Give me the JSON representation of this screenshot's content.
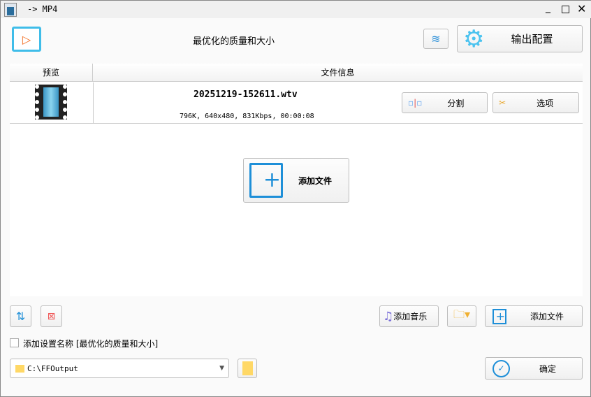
{
  "window": {
    "title": "-> MP4"
  },
  "header": {
    "preset": "最优化的质量和大小",
    "output_config": "输出配置"
  },
  "list": {
    "columns": [
      "预览",
      "文件信息"
    ],
    "files": [
      {
        "name": "20251219-152611.wtv",
        "info": "796K, 640x480, 831Kbps, 00:00:08",
        "split": "分割",
        "options": "选项"
      }
    ]
  },
  "center": {
    "add_file": "添加文件"
  },
  "toolbar": {
    "add_music": "添加音乐",
    "add_file": "添加文件"
  },
  "settings": {
    "add_name_label": "添加设置名称 [最优化的质量和大小]",
    "add_name_checked": false
  },
  "output": {
    "path": "C:\\FFOutput",
    "ok": "确定"
  }
}
